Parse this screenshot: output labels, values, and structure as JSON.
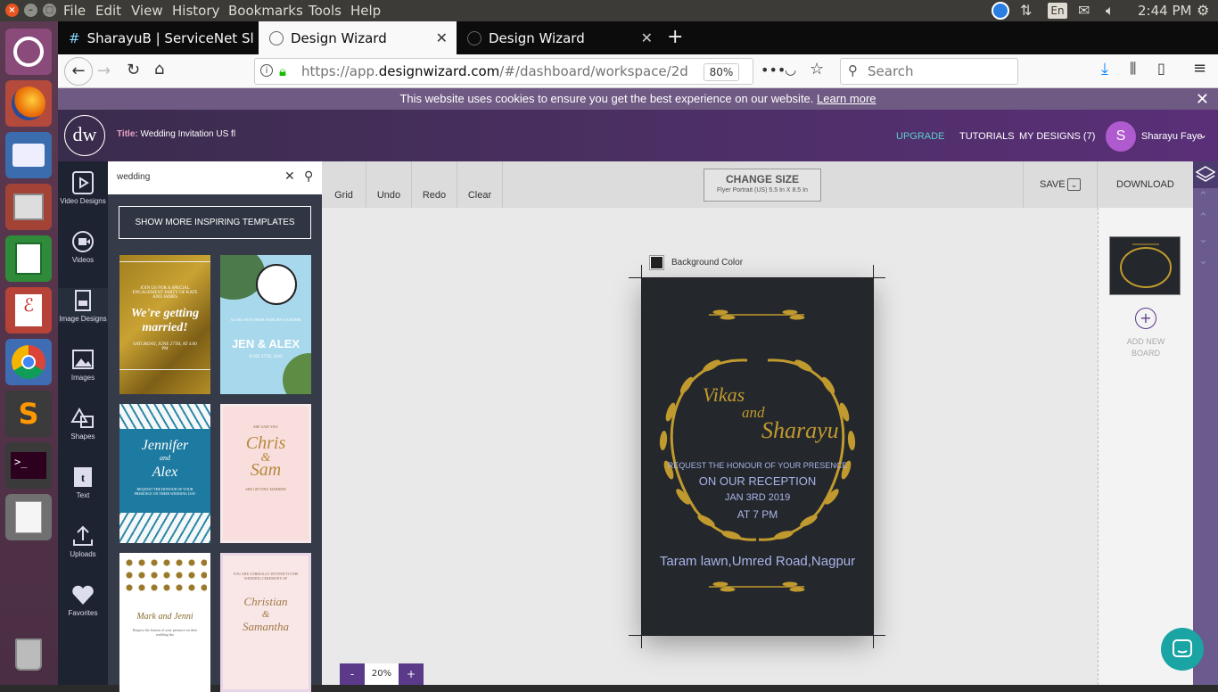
{
  "system": {
    "menu": [
      "File",
      "Edit",
      "View",
      "History",
      "Bookmarks",
      "Tools",
      "Help"
    ],
    "keyboard": "En",
    "time": "2:44 PM"
  },
  "browser": {
    "tabs": [
      {
        "label": "SharayuB | ServiceNet Sl"
      },
      {
        "label": "Design Wizard"
      },
      {
        "label": "Design Wizard"
      }
    ],
    "url_prefix": "https://app.",
    "url_domain": "designwizard.com",
    "url_rest": "/#/dashboard/workspace/2d",
    "zoom": "80%",
    "search_placeholder": "Search",
    "cookie_text": "This website uses cookies to ensure you get the best experience on our website.",
    "cookie_link": "Learn more"
  },
  "app": {
    "logo": "dw",
    "title_label": "Title:",
    "title_value": "Wedding Invitation US fl",
    "nav": {
      "upgrade": "UPGRADE",
      "tutorials": "TUTORIALS",
      "my_designs": "MY DESIGNS (7)"
    },
    "user": {
      "initial": "S",
      "name": "Sharayu Faye"
    },
    "sidebar": [
      {
        "label": "Video Designs",
        "icon": "video-design-icon"
      },
      {
        "label": "Videos",
        "icon": "video-icon"
      },
      {
        "label": "Image Designs",
        "icon": "image-design-icon"
      },
      {
        "label": "Images",
        "icon": "images-icon"
      },
      {
        "label": "Shapes",
        "icon": "shapes-icon"
      },
      {
        "label": "Text",
        "icon": "text-icon"
      },
      {
        "label": "Uploads",
        "icon": "upload-icon"
      },
      {
        "label": "Favorites",
        "icon": "heart-icon"
      }
    ],
    "search_value": "wedding",
    "more_templates": "SHOW MORE INSPIRING TEMPLATES",
    "templates": [
      {
        "small": "JOIN US FOR A SPECIAL ENGAGEMENT PARTY OF KATE AND JAMES",
        "main": "We're getting married!",
        "foot": "SATURDAY, JUNE 27TH, AT 4:00 PM"
      },
      {
        "small": "ALONG WITH THEIR FAMILIES TOGETHER",
        "main": "JEN & ALEX",
        "foot": "JUNE 27TH, 2019"
      },
      {
        "small": "",
        "main": "Jennifer",
        "and": "and",
        "main2": "Alex",
        "foot": "REQUEST THE HONOUR OF YOUR PRESENCE ON THEIR WEDDING DAY"
      },
      {
        "small": "SHE SAID YES!",
        "main": "Chris",
        "and": "&",
        "main2": "Sam",
        "foot": "ARE GETTING MARRIED"
      },
      {
        "small": "",
        "main": "Mark and Jenni",
        "foot": "Request the honour of your presence on their wedding day"
      },
      {
        "small": "YOU ARE CORDIALLY INVITED TO THE WEDDING CEREMONY OF",
        "main": "Christian",
        "and": "&",
        "main2": "Samantha",
        "foot": ""
      }
    ],
    "toolbar": {
      "grid": "Grid",
      "undo": "Undo",
      "redo": "Redo",
      "clear": "Clear",
      "change_size": "CHANGE SIZE",
      "size_detail": "Flyer Portrait (US) 5.5 In X 8.5 In",
      "save": "SAVE",
      "download": "DOWNLOAD"
    },
    "bg_color_label": "Background Color",
    "card": {
      "name1": "Vikas",
      "and": "and",
      "name2": "Sharayu",
      "line1": "REQUEST THE HONOUR OF YOUR PRESENCE",
      "line2": "ON OUR RECEPTION",
      "line3": "JAN 3RD 2019",
      "line4": "AT 7 PM",
      "venue": "Taram lawn,Umred Road,Nagpur"
    },
    "add_board": "ADD NEW BOARD",
    "zoom": {
      "minus": "-",
      "value": "20%",
      "plus": "+"
    }
  }
}
